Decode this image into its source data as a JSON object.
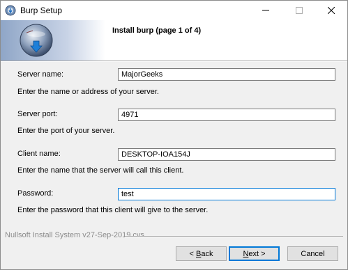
{
  "window": {
    "title": "Burp Setup",
    "icon": "burp-installer-icon",
    "controls": {
      "minimize": "minimize-icon",
      "maximize": "maximize-icon",
      "close": "close-icon"
    }
  },
  "header": {
    "title": "Install burp (page 1 of 4)",
    "logo": "burp-logo-icon"
  },
  "form": {
    "server_name": {
      "label": "Server name:",
      "value": "MajorGeeks",
      "hint": "Enter the name or address of your server."
    },
    "server_port": {
      "label": "Server port:",
      "value": "4971",
      "hint": "Enter the port of your server."
    },
    "client_name": {
      "label": "Client name:",
      "value": "DESKTOP-IOA154J",
      "hint": "Enter the name that the server will call this client."
    },
    "password": {
      "label": "Password:",
      "value": "test",
      "hint": "Enter the password that this client will give to the server."
    }
  },
  "footer": {
    "brand": "Nullsoft Install System v27-Sep-2019.cvs",
    "buttons": {
      "back": {
        "accel": "B",
        "prefix": "< ",
        "rest": "ack"
      },
      "next": {
        "accel": "N",
        "prefix": "",
        "rest": "ext >"
      },
      "cancel": "Cancel"
    }
  },
  "colors": {
    "accent": "#0078d7",
    "window_bg": "#f0f0f0",
    "header_gradient_start": "#8fa6c7"
  }
}
